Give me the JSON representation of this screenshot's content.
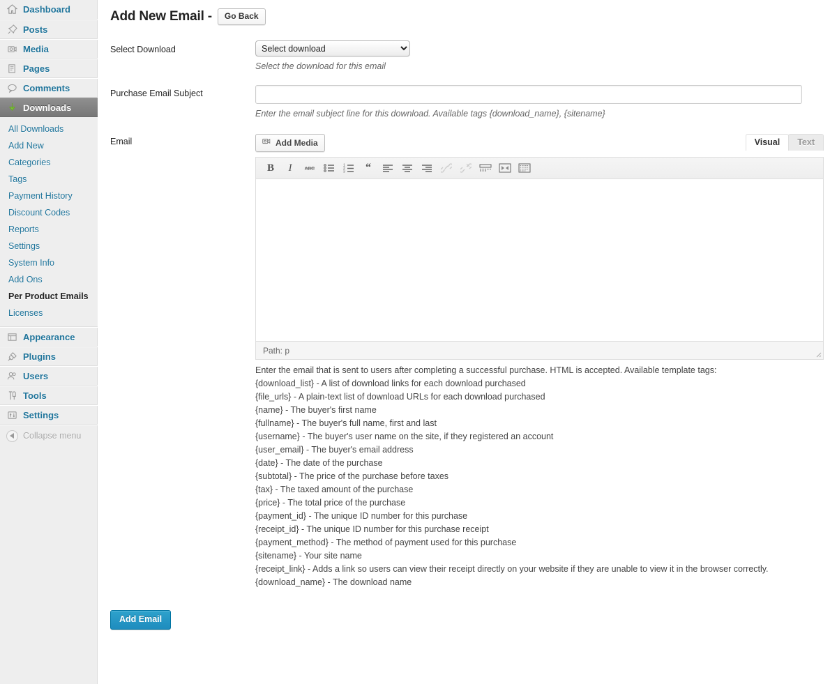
{
  "sidebar": {
    "top_items": [
      {
        "label": "Dashboard",
        "icon": "dashboard-icon",
        "current": false
      },
      {
        "label": "Posts",
        "icon": "pin-icon",
        "current": false
      },
      {
        "label": "Media",
        "icon": "camera-icon",
        "current": false
      },
      {
        "label": "Pages",
        "icon": "page-icon",
        "current": false
      },
      {
        "label": "Comments",
        "icon": "comment-bubble-icon",
        "current": false
      },
      {
        "label": "Downloads",
        "icon": "download-arrow-icon",
        "current": true
      }
    ],
    "downloads_submenu": [
      {
        "label": "All Downloads",
        "current": false
      },
      {
        "label": "Add New",
        "current": false
      },
      {
        "label": "Categories",
        "current": false
      },
      {
        "label": "Tags",
        "current": false
      },
      {
        "label": "Payment History",
        "current": false
      },
      {
        "label": "Discount Codes",
        "current": false
      },
      {
        "label": "Reports",
        "current": false
      },
      {
        "label": "Settings",
        "current": false
      },
      {
        "label": "System Info",
        "current": false
      },
      {
        "label": "Add Ons",
        "current": false
      },
      {
        "label": "Per Product Emails",
        "current": true
      },
      {
        "label": "Licenses",
        "current": false
      }
    ],
    "bottom_items": [
      {
        "label": "Appearance",
        "icon": "appearance-icon"
      },
      {
        "label": "Plugins",
        "icon": "plug-icon"
      },
      {
        "label": "Users",
        "icon": "users-icon"
      },
      {
        "label": "Tools",
        "icon": "tools-icon"
      },
      {
        "label": "Settings",
        "icon": "settings-sliders-icon"
      }
    ],
    "collapse_label": "Collapse menu"
  },
  "header": {
    "title": "Add New Email -",
    "go_back_label": "Go Back"
  },
  "form": {
    "select_download": {
      "label": "Select Download",
      "selected_option": "Select download",
      "options": [
        "Select download"
      ],
      "description": "Select the download for this email"
    },
    "purchase_email_subject": {
      "label": "Purchase Email Subject",
      "value": "",
      "placeholder": "",
      "description": "Enter the email subject line for this download. Available tags {download_name}, {sitename}"
    },
    "email": {
      "label": "Email",
      "add_media_label": "Add Media",
      "tabs": [
        {
          "label": "Visual",
          "active": true
        },
        {
          "label": "Text",
          "active": false
        }
      ],
      "toolbar_buttons": [
        {
          "name": "bold-icon",
          "glyph": "B",
          "disabled": false
        },
        {
          "name": "italic-icon",
          "glyph": "I",
          "disabled": false
        },
        {
          "name": "strikethrough-icon",
          "glyph": "ABC",
          "disabled": false
        },
        {
          "name": "bulleted-list-icon",
          "glyph": "•—",
          "disabled": false
        },
        {
          "name": "numbered-list-icon",
          "glyph": "1—",
          "disabled": false
        },
        {
          "name": "blockquote-icon",
          "glyph": "“",
          "disabled": false
        },
        {
          "name": "align-left-icon",
          "glyph": "≡",
          "disabled": false
        },
        {
          "name": "align-center-icon",
          "glyph": "≡",
          "disabled": false
        },
        {
          "name": "align-right-icon",
          "glyph": "≡",
          "disabled": false
        },
        {
          "name": "insert-link-icon",
          "glyph": "⚭",
          "disabled": true
        },
        {
          "name": "remove-link-icon",
          "glyph": "⚭",
          "disabled": true
        },
        {
          "name": "insert-more-tag-icon",
          "glyph": "☰",
          "disabled": false
        },
        {
          "name": "fullscreen-icon",
          "glyph": "⤢",
          "disabled": false
        },
        {
          "name": "toolbar-toggle-icon",
          "glyph": "☷",
          "disabled": false
        }
      ],
      "content": "",
      "status_path_label": "Path: p",
      "description_intro": "Enter the email that is sent to users after completing a successful purchase. HTML is accepted. Available template tags:",
      "template_tags": [
        "{download_list} - A list of download links for each download purchased",
        "{file_urls} - A plain-text list of download URLs for each download purchased",
        "{name} - The buyer's first name",
        "{fullname} - The buyer's full name, first and last",
        "{username} - The buyer's user name on the site, if they registered an account",
        "{user_email} - The buyer's email address",
        "{date} - The date of the purchase",
        "{subtotal} - The price of the purchase before taxes",
        "{tax} - The taxed amount of the purchase",
        "{price} - The total price of the purchase",
        "{payment_id} - The unique ID number for this purchase",
        "{receipt_id} - The unique ID number for this purchase receipt",
        "{payment_method} - The method of payment used for this purchase",
        "{sitename} - Your site name",
        "{receipt_link} - Adds a link so users can view their receipt directly on your website if they are unable to view it in the browser correctly.",
        "{download_name} - The download name"
      ]
    },
    "submit_label": "Add Email"
  },
  "colors": {
    "primary_button": "#2ea2cc",
    "link": "#21759b",
    "sidebar_bg": "#eeeeee",
    "current_menu_bg": "#777777",
    "download_icon_green": "#6ca62c"
  }
}
